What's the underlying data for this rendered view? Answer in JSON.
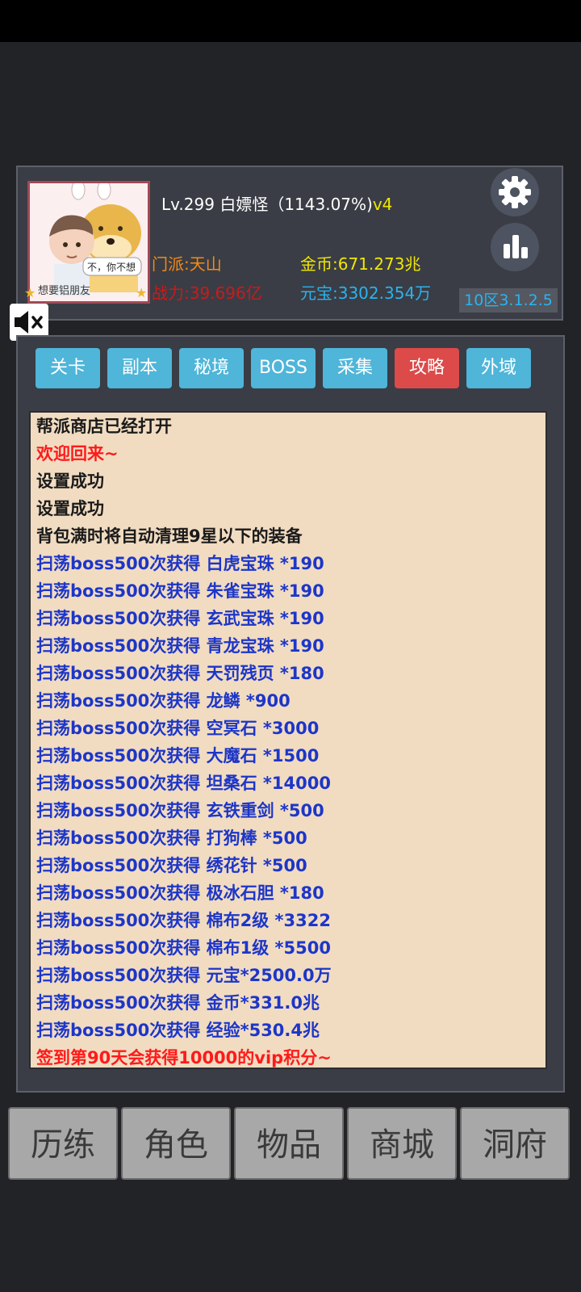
{
  "player": {
    "level_name": "Lv.299 白嫖怪（1143.07%)",
    "vip": "v4",
    "sect": "门派:天山",
    "power": "战力:39.696亿",
    "gold": "金币:671.273兆",
    "ingot": "元宝:3302.354万",
    "server_version": "10区3.1.2.5",
    "avatar_bubble": "不，你不想",
    "avatar_caption": "想要铝朋友"
  },
  "tabs": [
    {
      "label": "关卡",
      "active": false
    },
    {
      "label": "副本",
      "active": false
    },
    {
      "label": "秘境",
      "active": false
    },
    {
      "label": "BOSS",
      "active": false
    },
    {
      "label": "采集",
      "active": false
    },
    {
      "label": "攻略",
      "active": true
    },
    {
      "label": "外域",
      "active": false
    }
  ],
  "log": [
    {
      "text": "帮派商店已经打开",
      "color": "black"
    },
    {
      "text": "欢迎回来~",
      "color": "red"
    },
    {
      "text": "设置成功",
      "color": "black"
    },
    {
      "text": "设置成功",
      "color": "black"
    },
    {
      "text": "背包满时将自动清理9星以下的装备",
      "color": "black"
    },
    {
      "text": "扫荡boss500次获得 白虎宝珠 *190",
      "color": "blue"
    },
    {
      "text": "扫荡boss500次获得 朱雀宝珠 *190",
      "color": "blue"
    },
    {
      "text": "扫荡boss500次获得 玄武宝珠 *190",
      "color": "blue"
    },
    {
      "text": "扫荡boss500次获得 青龙宝珠 *190",
      "color": "blue"
    },
    {
      "text": "扫荡boss500次获得 天罚残页 *180",
      "color": "blue"
    },
    {
      "text": "扫荡boss500次获得 龙鳞 *900",
      "color": "blue"
    },
    {
      "text": "扫荡boss500次获得 空冥石 *3000",
      "color": "blue"
    },
    {
      "text": "扫荡boss500次获得 大魔石 *1500",
      "color": "blue"
    },
    {
      "text": "扫荡boss500次获得 坦桑石 *14000",
      "color": "blue"
    },
    {
      "text": "扫荡boss500次获得 玄铁重剑 *500",
      "color": "blue"
    },
    {
      "text": "扫荡boss500次获得 打狗棒 *500",
      "color": "blue"
    },
    {
      "text": "扫荡boss500次获得 绣花针 *500",
      "color": "blue"
    },
    {
      "text": "扫荡boss500次获得 极冰石胆 *180",
      "color": "blue"
    },
    {
      "text": "扫荡boss500次获得 棉布2级 *3322",
      "color": "blue"
    },
    {
      "text": "扫荡boss500次获得 棉布1级 *5500",
      "color": "blue"
    },
    {
      "text": "扫荡boss500次获得 元宝*2500.0万",
      "color": "blue"
    },
    {
      "text": "扫荡boss500次获得 金币*331.0兆",
      "color": "blue"
    },
    {
      "text": "扫荡boss500次获得 经验*530.4兆",
      "color": "blue"
    },
    {
      "text": "签到第90天会获得10000的vip积分~",
      "color": "red"
    }
  ],
  "nav": [
    "历练",
    "角色",
    "物品",
    "商城",
    "洞府"
  ],
  "icons": {
    "settings": "gear-icon",
    "stats": "bar-chart-icon",
    "sound": "speaker-muted-icon"
  },
  "colors": {
    "tab": "#4fb5d9",
    "tab_active": "#dc4a4a",
    "log_bg": "#f1dcc2",
    "gold": "#f2e600",
    "ingot": "#2ab3f0",
    "sect": "#f58a14",
    "power": "#cc1a1a"
  }
}
